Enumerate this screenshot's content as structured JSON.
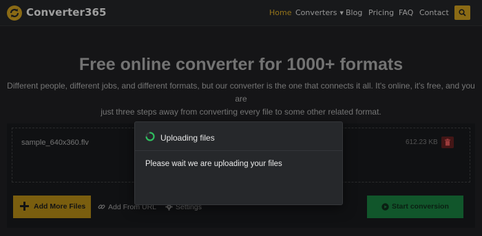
{
  "header": {
    "brand": "Converter365",
    "nav": {
      "home": "Home",
      "converters": "Converters",
      "blog": "Blog",
      "pricing": "Pricing",
      "faq": "FAQ",
      "contact": "Contact"
    },
    "search_icon": "search-icon"
  },
  "hero": {
    "title": "Free online converter for 1000+ formats",
    "line1": "Different people, different jobs, and different formats, but our converter is the one that connects it all. It's online, it's free, and you are",
    "line2": "just three steps away from converting every file to some other related format."
  },
  "upload": {
    "file": {
      "name": "sample_640x360.flv",
      "size": "612.23 KB"
    },
    "add_files": "Add More Files",
    "from_url": "Add From URL",
    "settings": "Settings",
    "start": "Start conversion"
  },
  "modal": {
    "title": "Uploading files",
    "message": "Please wait we are uploading your files"
  },
  "colors": {
    "accent": "#c59a23",
    "add_button": "#a37e15",
    "start_button": "#17733a",
    "delete_button": "#5a1e1e",
    "spinner": "#2fbf5f",
    "background": "#1c1d1f"
  }
}
